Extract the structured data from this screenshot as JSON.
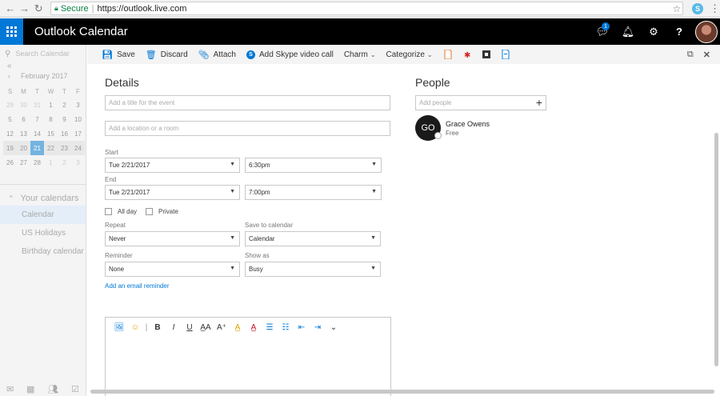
{
  "browser": {
    "secure_label": "Secure",
    "url": "https://outlook.live.com"
  },
  "header": {
    "title": "Outlook Calendar",
    "notification_count": "1"
  },
  "sidebar": {
    "search_placeholder": "Search Calendar",
    "month_label": "February 2017",
    "weekdays": [
      "S",
      "M",
      "T",
      "W",
      "T",
      "F"
    ],
    "weeks": [
      [
        "29",
        "30",
        "31",
        "1",
        "2",
        "3"
      ],
      [
        "5",
        "6",
        "7",
        "8",
        "9",
        "10"
      ],
      [
        "12",
        "13",
        "14",
        "15",
        "16",
        "17"
      ],
      [
        "19",
        "20",
        "21",
        "22",
        "23",
        "24"
      ],
      [
        "26",
        "27",
        "28",
        "1",
        "2",
        "3"
      ]
    ],
    "your_calendars_label": "Your calendars",
    "calendars": [
      "Calendar",
      "US Holidays",
      "Birthday calendar"
    ]
  },
  "commands": {
    "save": "Save",
    "discard": "Discard",
    "attach": "Attach",
    "skype": "Add Skype video call",
    "charm": "Charm",
    "categorize": "Categorize"
  },
  "form": {
    "details_heading": "Details",
    "title_placeholder": "Add a title for the event",
    "location_placeholder": "Add a location or a room",
    "start_label": "Start",
    "start_date": "Tue 2/21/2017",
    "start_time": "6:30pm",
    "end_label": "End",
    "end_date": "Tue 2/21/2017",
    "end_time": "7:00pm",
    "all_day_label": "All day",
    "private_label": "Private",
    "repeat_label": "Repeat",
    "repeat_value": "Never",
    "save_to_label": "Save to calendar",
    "save_to_value": "Calendar",
    "reminder_label": "Reminder",
    "reminder_value": "None",
    "show_as_label": "Show as",
    "show_as_value": "Busy",
    "email_reminder_link": "Add an email reminder"
  },
  "people": {
    "heading": "People",
    "add_placeholder": "Add people",
    "person_initials": "GO",
    "person_name": "Grace Owens",
    "person_status": "Free"
  },
  "editor_toolbar": {
    "bold": "B",
    "italic": "I",
    "underline": "U"
  },
  "colors": {
    "accent": "#0078d7",
    "header_bg": "#000000",
    "today_bg": "#74b3e0"
  }
}
